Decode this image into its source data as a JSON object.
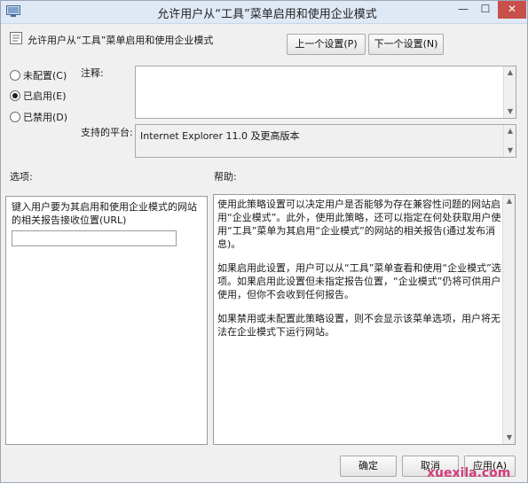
{
  "window": {
    "title": "允许用户从“工具”菜单启用和使用企业模式",
    "close_label": "✕",
    "min_label": "—",
    "max_label": "☐"
  },
  "header": {
    "policy_name": "允许用户从“工具”菜单启用和使用企业模式",
    "prev_button": "上一个设置(P)",
    "next_button": "下一个设置(N)"
  },
  "state": {
    "options": [
      {
        "label": "未配置(C)",
        "checked": false
      },
      {
        "label": "已启用(E)",
        "checked": true
      },
      {
        "label": "已禁用(D)",
        "checked": false
      }
    ]
  },
  "comment": {
    "label": "注释:",
    "value": ""
  },
  "supported": {
    "label": "支持的平台:",
    "value": "Internet Explorer 11.0 及更高版本"
  },
  "options_label": "选项:",
  "help_label": "帮助:",
  "option_panel": {
    "description": "键入用户要为其启用和使用企业模式的网站的相关报告接收位置(URL)",
    "url_value": ""
  },
  "help": {
    "paragraphs": [
      "使用此策略设置可以决定用户是否能够为存在兼容性问题的网站启用“企业模式”。此外，使用此策略，还可以指定在何处获取用户使用“工具”菜单为其启用“企业模式”的网站的相关报告(通过发布消息)。",
      "如果启用此设置，用户可以从“工具”菜单查看和使用“企业模式”选项。如果启用此设置但未指定报告位置，“企业模式”仍将可供用户使用，但你不会收到任何报告。",
      "如果禁用或未配置此策略设置，则不会显示该菜单选项，用户将无法在企业模式下运行网站。"
    ]
  },
  "footer": {
    "ok": "确定",
    "cancel": "取消",
    "apply": "应用(A)"
  },
  "watermark": "xuexila.com"
}
